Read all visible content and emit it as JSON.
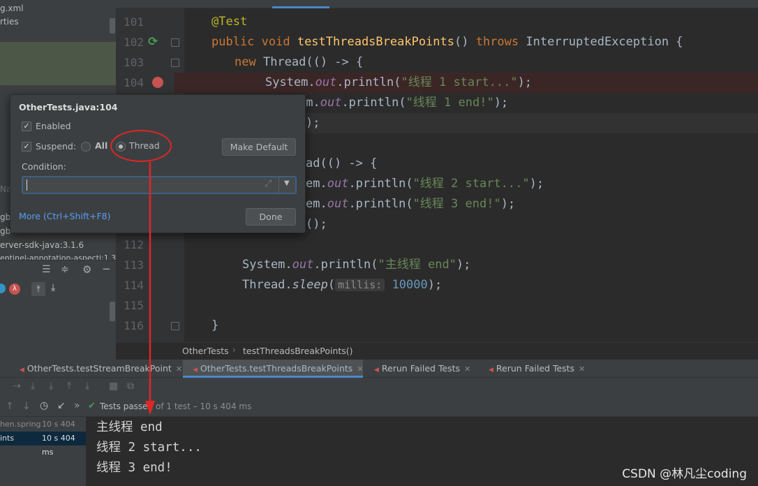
{
  "project_tree": {
    "items": [
      "g.xml",
      "rties",
      "Na",
      "gb",
      "gb",
      "erver-sdk-java:3.1.6",
      "entinel-annotation-aspectj:1.3"
    ]
  },
  "editor": {
    "lines": [
      {
        "num": "101"
      },
      {
        "num": "102"
      },
      {
        "num": "103"
      },
      {
        "num": "104"
      },
      {
        "num": "112"
      },
      {
        "num": "113"
      },
      {
        "num": "114"
      },
      {
        "num": "115"
      },
      {
        "num": "116"
      }
    ],
    "code": {
      "l101": "@Test",
      "l102_kw": "public void ",
      "l102_fn": "testThreadsBreakPoints",
      "l102_mid": "() ",
      "l102_throws": "throws ",
      "l102_end": "InterruptedException {",
      "l103_kw": "new ",
      "l103_end": "Thread(() -> {",
      "l104_a": "System.",
      "l104_b": "out",
      "l104_c": ".println(",
      "l104_d": "\"线程 1 start...\"",
      "l104_e": ");",
      "l105_a": "em.",
      "l105_b": "out",
      "l105_c": ".println(",
      "l105_d": "\"线程 1 end!\"",
      "l105_e": ");",
      "l106": ");",
      "l108": "ad(() -> {",
      "l109_a": "em.",
      "l109_b": "out",
      "l109_c": ".println(",
      "l109_d": "\"线程 2 start...\"",
      "l109_e": ");",
      "l110_a": "em.",
      "l110_b": "out",
      "l110_c": ".println(",
      "l110_d": "\"线程 3 end!\"",
      "l110_e": ");",
      "l111": "();",
      "l113_a": "System.",
      "l113_b": "out",
      "l113_c": ".println(",
      "l113_d": "\"主线程 end\"",
      "l113_e": ");",
      "l114_a": "Thread.",
      "l114_b": "sleep",
      "l114_c": "(",
      "l114_hint": "millis:",
      "l114_num": "10000",
      "l114_e": ");",
      "l116": "}"
    }
  },
  "breakpoint_dialog": {
    "title": "OtherTests.java:104",
    "enabled_label": "Enabled",
    "suspend_label": "Suspend:",
    "all_label": "All",
    "thread_label": "Thread",
    "make_default_label": "Make Default",
    "condition_label": "Condition:",
    "condition_value": "",
    "more_label": "More (Ctrl+Shift+F8)",
    "done_label": "Done",
    "enabled_checked": true,
    "suspend_checked": true,
    "suspend_mode": "Thread"
  },
  "breadcrumb": {
    "items": [
      "OtherTests",
      "testThreadsBreakPoints()"
    ]
  },
  "run_tabs": [
    {
      "label": "OtherTests.testStreamBreakPoint",
      "active": false
    },
    {
      "label": "OtherTests.testThreadsBreakPoints",
      "active": true
    },
    {
      "label": "Rerun Failed Tests",
      "active": false
    },
    {
      "label": "Rerun Failed Tests",
      "active": false
    }
  ],
  "test_status": {
    "prefix": "Tests passe",
    "count": "1",
    "rest": " of 1 test – 10 s 404 ms"
  },
  "test_tree": {
    "items": [
      {
        "label": "hen.spring",
        "time": "10 s 404 ms"
      },
      {
        "label": "ints",
        "time": "10 s 404 ms"
      }
    ]
  },
  "console": {
    "lines": [
      "主线程 end",
      "线程 2 start...",
      "线程 3 end!"
    ]
  },
  "watermark": "CSDN @林凡尘coding",
  "colors": {
    "annotation_red": "#e02626",
    "breakpoint_red": "#c75450",
    "pass_green": "#499c54",
    "link_blue": "#589df6"
  }
}
